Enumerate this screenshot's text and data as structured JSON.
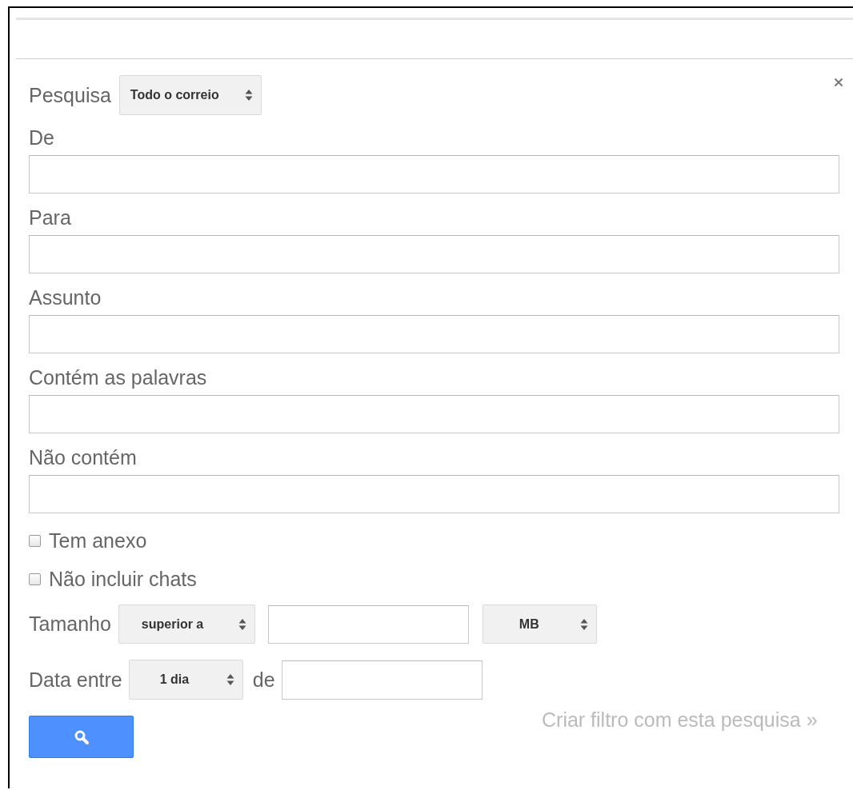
{
  "search_scope": {
    "label": "Pesquisa",
    "value": "Todo o correio"
  },
  "fields": [
    {
      "label": "De"
    },
    {
      "label": "Para"
    },
    {
      "label": "Assunto"
    },
    {
      "label": "Contém as palavras"
    },
    {
      "label": "Não contém"
    }
  ],
  "options": [
    {
      "label": "Tem anexo",
      "checked": false
    },
    {
      "label": "Não incluir chats",
      "checked": false
    }
  ],
  "size": {
    "label": "Tamanho",
    "comparator": "superior a",
    "unit": "MB"
  },
  "date": {
    "label": "Data entre",
    "range": "1 dia",
    "joiner": "de"
  },
  "create_filter_link": "Criar filtro com esta pesquisa »"
}
